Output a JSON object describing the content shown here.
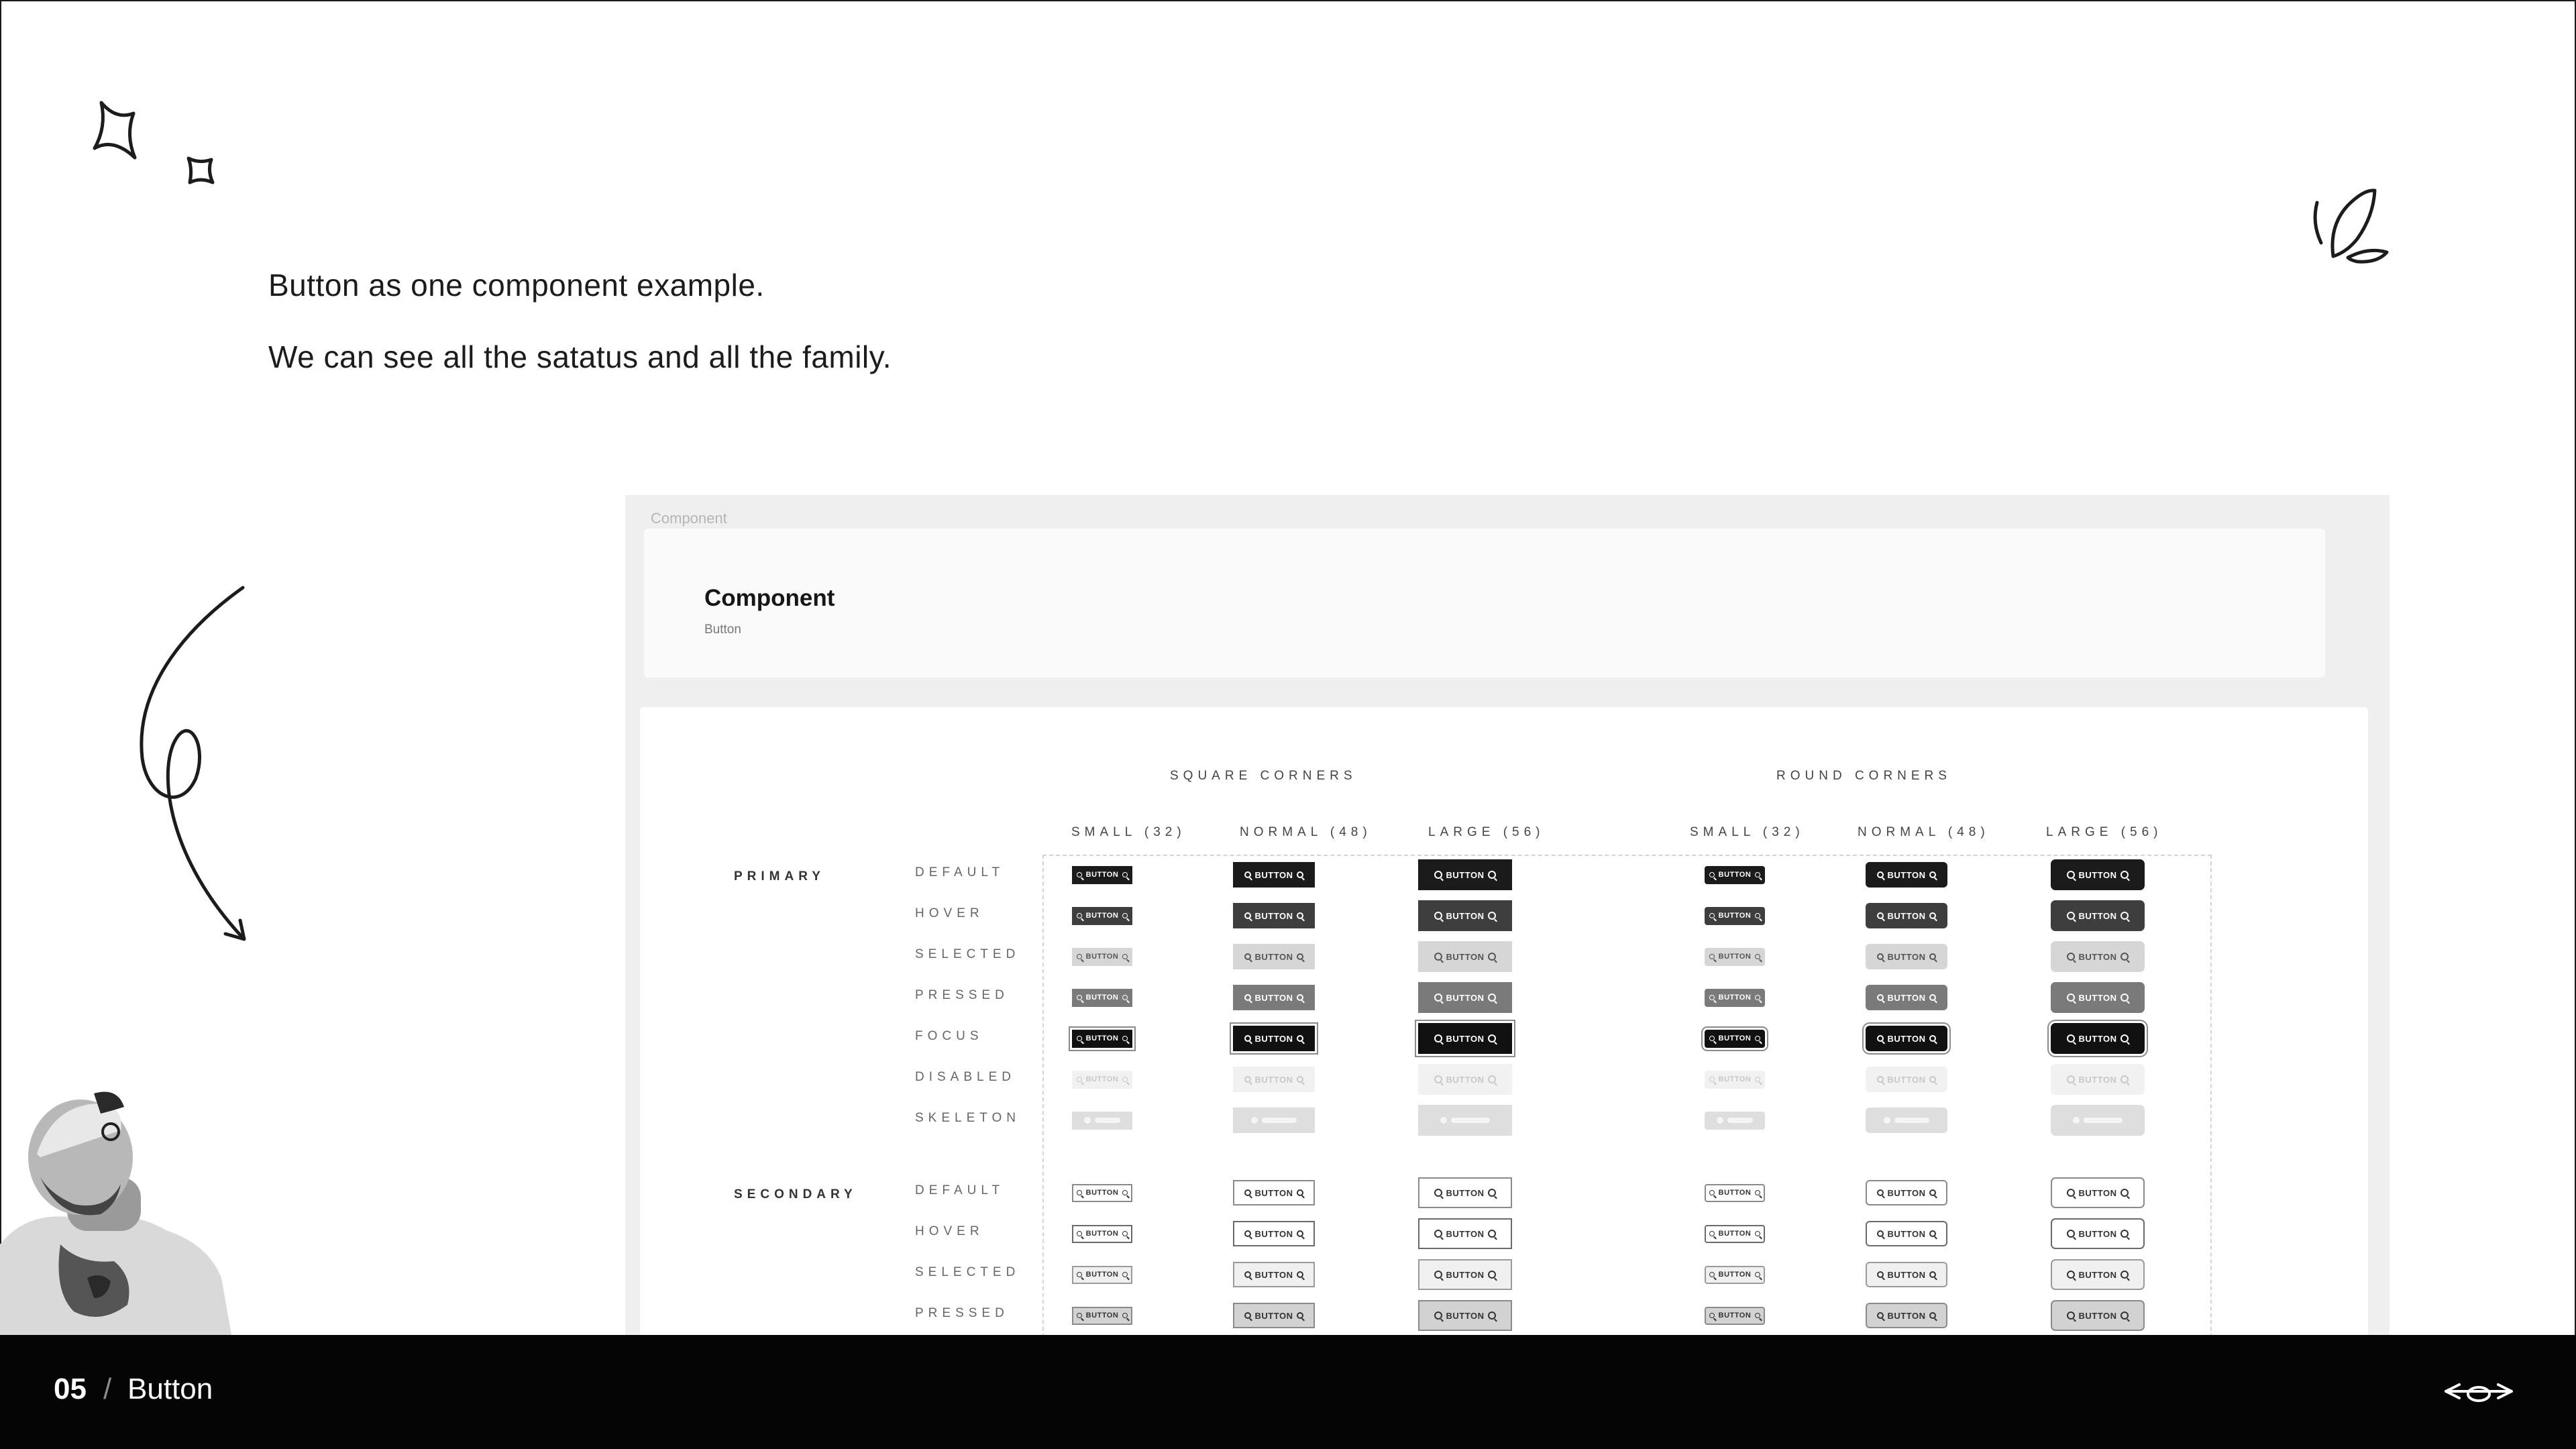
{
  "intro": {
    "line1": "Button as one component example.",
    "line2": "We can see all the satatus and all the family."
  },
  "component": {
    "frame_label": "Component",
    "title": "Component",
    "subtitle": "Button",
    "groups": {
      "square": "SQUARE CORNERS",
      "round": "ROUND CORNERS"
    },
    "sizes": [
      "SMALL (32)",
      "NORMAL (48)",
      "LARGE (56)"
    ],
    "button_label": "BUTTON",
    "primary": {
      "label": "PRIMARY",
      "states": [
        "DEFAULT",
        "HOVER",
        "SELECTED",
        "PRESSED",
        "FOCUS",
        "DISABLED",
        "SKELETON"
      ]
    },
    "secondary": {
      "label": "SECONDARY",
      "states": [
        "DEFAULT",
        "HOVER",
        "SELECTED",
        "PRESSED"
      ]
    }
  },
  "footer": {
    "page_number": "05",
    "separator": "/",
    "section": "Button"
  },
  "icons": [
    "sparkle-icon",
    "small-sparkle-icon",
    "leaf-doodle-icon",
    "curly-arrow-icon",
    "search-icon",
    "glasses-nav-icon"
  ],
  "colors": {
    "footer_bg": "#050505",
    "primary_default": "#1b1b1b",
    "canvas_bg": "#efefef"
  }
}
